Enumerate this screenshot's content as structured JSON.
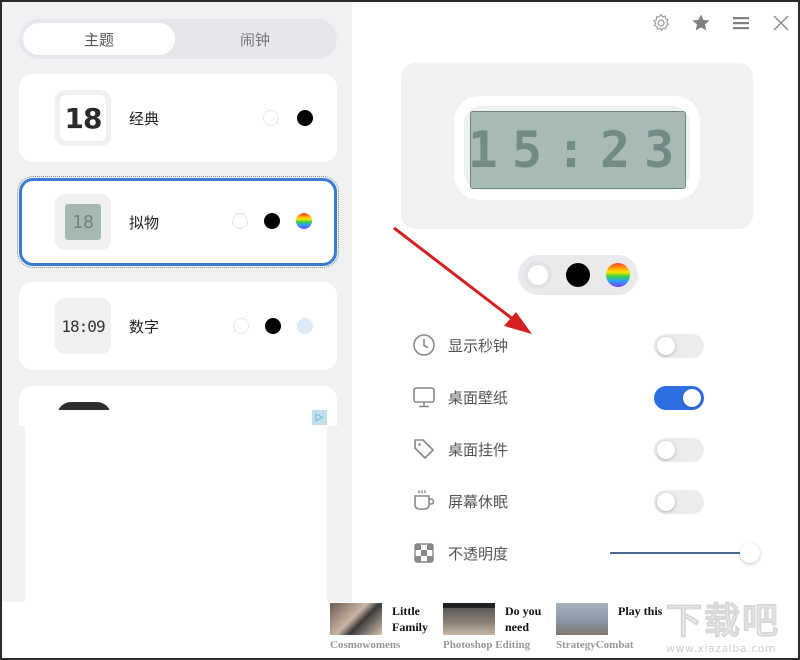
{
  "left_panel": {
    "tabs": [
      {
        "label": "主题",
        "active": true
      },
      {
        "label": "闹钟",
        "active": false
      }
    ],
    "themes": [
      {
        "name": "经典",
        "thumb_text": "18",
        "colors": [
          "white",
          "black"
        ],
        "selected": false
      },
      {
        "name": "拟物",
        "thumb_text": "18",
        "colors": [
          "white",
          "black",
          "rainbow"
        ],
        "selected": true
      },
      {
        "name": "数字",
        "thumb_text": "18:09",
        "colors": [
          "white",
          "black",
          "lightblue"
        ],
        "selected": false
      }
    ],
    "ad_choice_icon": "▷"
  },
  "toolbar": {
    "icons": [
      "gear-icon",
      "star-icon",
      "menu-icon",
      "close-icon"
    ]
  },
  "preview": {
    "time": "15:23",
    "hours": "15",
    "minutes": "23",
    "color_options": [
      "white",
      "black",
      "rainbow"
    ],
    "selected_color": "white"
  },
  "settings": [
    {
      "label": "显示秒钟",
      "icon": "clock-icon",
      "type": "toggle",
      "on": false
    },
    {
      "label": "桌面壁纸",
      "icon": "monitor-icon",
      "type": "toggle",
      "on": true
    },
    {
      "label": "桌面挂件",
      "icon": "tag-icon",
      "type": "toggle",
      "on": false
    },
    {
      "label": "屏幕休眠",
      "icon": "coffee-cup-icon",
      "type": "toggle",
      "on": false
    },
    {
      "label": "不透明度",
      "icon": "checkerboard-icon",
      "type": "slider",
      "value_percent": 100
    }
  ],
  "ads": [
    {
      "title": "Little Family",
      "source": "Cosmowomens"
    },
    {
      "title": "Do you need",
      "source": "Photoshop Editing"
    },
    {
      "title": "Play this",
      "source": "StrategyCombat"
    }
  ],
  "watermark": {
    "big": "下载吧",
    "small": "www.xiazaiba.com"
  },
  "colors": {
    "accent": "#2f6fe4",
    "selected_border": "#3a7bd5",
    "panel_bg": "#f0f1f3",
    "lcd_bg": "#a8bab6",
    "arrow": "#d42020"
  }
}
